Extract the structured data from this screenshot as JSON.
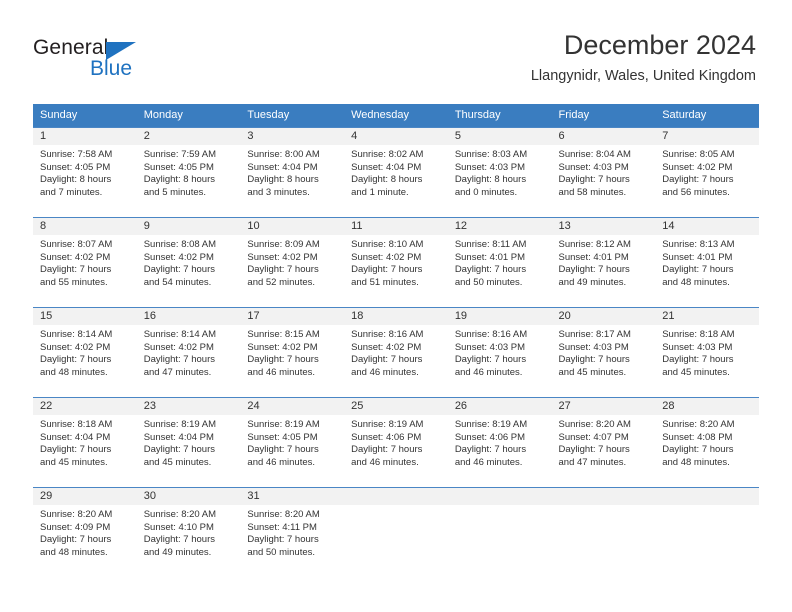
{
  "brand": {
    "name_part1": "General",
    "name_part2": "Blue",
    "accent_color": "#1f72c0"
  },
  "header": {
    "title": "December 2024",
    "subtitle": "Llangynidr, Wales, United Kingdom"
  },
  "theme": {
    "header_row_color": "#3a7dc0",
    "day_band_color": "#f2f2f2",
    "text_color": "#333333"
  },
  "weekday_headers": [
    "Sunday",
    "Monday",
    "Tuesday",
    "Wednesday",
    "Thursday",
    "Friday",
    "Saturday"
  ],
  "weeks": [
    [
      {
        "day": "1",
        "sunrise": "Sunrise: 7:58 AM",
        "sunset": "Sunset: 4:05 PM",
        "daylight_line1": "Daylight: 8 hours",
        "daylight_line2": "and 7 minutes."
      },
      {
        "day": "2",
        "sunrise": "Sunrise: 7:59 AM",
        "sunset": "Sunset: 4:05 PM",
        "daylight_line1": "Daylight: 8 hours",
        "daylight_line2": "and 5 minutes."
      },
      {
        "day": "3",
        "sunrise": "Sunrise: 8:00 AM",
        "sunset": "Sunset: 4:04 PM",
        "daylight_line1": "Daylight: 8 hours",
        "daylight_line2": "and 3 minutes."
      },
      {
        "day": "4",
        "sunrise": "Sunrise: 8:02 AM",
        "sunset": "Sunset: 4:04 PM",
        "daylight_line1": "Daylight: 8 hours",
        "daylight_line2": "and 1 minute."
      },
      {
        "day": "5",
        "sunrise": "Sunrise: 8:03 AM",
        "sunset": "Sunset: 4:03 PM",
        "daylight_line1": "Daylight: 8 hours",
        "daylight_line2": "and 0 minutes."
      },
      {
        "day": "6",
        "sunrise": "Sunrise: 8:04 AM",
        "sunset": "Sunset: 4:03 PM",
        "daylight_line1": "Daylight: 7 hours",
        "daylight_line2": "and 58 minutes."
      },
      {
        "day": "7",
        "sunrise": "Sunrise: 8:05 AM",
        "sunset": "Sunset: 4:02 PM",
        "daylight_line1": "Daylight: 7 hours",
        "daylight_line2": "and 56 minutes."
      }
    ],
    [
      {
        "day": "8",
        "sunrise": "Sunrise: 8:07 AM",
        "sunset": "Sunset: 4:02 PM",
        "daylight_line1": "Daylight: 7 hours",
        "daylight_line2": "and 55 minutes."
      },
      {
        "day": "9",
        "sunrise": "Sunrise: 8:08 AM",
        "sunset": "Sunset: 4:02 PM",
        "daylight_line1": "Daylight: 7 hours",
        "daylight_line2": "and 54 minutes."
      },
      {
        "day": "10",
        "sunrise": "Sunrise: 8:09 AM",
        "sunset": "Sunset: 4:02 PM",
        "daylight_line1": "Daylight: 7 hours",
        "daylight_line2": "and 52 minutes."
      },
      {
        "day": "11",
        "sunrise": "Sunrise: 8:10 AM",
        "sunset": "Sunset: 4:02 PM",
        "daylight_line1": "Daylight: 7 hours",
        "daylight_line2": "and 51 minutes."
      },
      {
        "day": "12",
        "sunrise": "Sunrise: 8:11 AM",
        "sunset": "Sunset: 4:01 PM",
        "daylight_line1": "Daylight: 7 hours",
        "daylight_line2": "and 50 minutes."
      },
      {
        "day": "13",
        "sunrise": "Sunrise: 8:12 AM",
        "sunset": "Sunset: 4:01 PM",
        "daylight_line1": "Daylight: 7 hours",
        "daylight_line2": "and 49 minutes."
      },
      {
        "day": "14",
        "sunrise": "Sunrise: 8:13 AM",
        "sunset": "Sunset: 4:01 PM",
        "daylight_line1": "Daylight: 7 hours",
        "daylight_line2": "and 48 minutes."
      }
    ],
    [
      {
        "day": "15",
        "sunrise": "Sunrise: 8:14 AM",
        "sunset": "Sunset: 4:02 PM",
        "daylight_line1": "Daylight: 7 hours",
        "daylight_line2": "and 48 minutes."
      },
      {
        "day": "16",
        "sunrise": "Sunrise: 8:14 AM",
        "sunset": "Sunset: 4:02 PM",
        "daylight_line1": "Daylight: 7 hours",
        "daylight_line2": "and 47 minutes."
      },
      {
        "day": "17",
        "sunrise": "Sunrise: 8:15 AM",
        "sunset": "Sunset: 4:02 PM",
        "daylight_line1": "Daylight: 7 hours",
        "daylight_line2": "and 46 minutes."
      },
      {
        "day": "18",
        "sunrise": "Sunrise: 8:16 AM",
        "sunset": "Sunset: 4:02 PM",
        "daylight_line1": "Daylight: 7 hours",
        "daylight_line2": "and 46 minutes."
      },
      {
        "day": "19",
        "sunrise": "Sunrise: 8:16 AM",
        "sunset": "Sunset: 4:03 PM",
        "daylight_line1": "Daylight: 7 hours",
        "daylight_line2": "and 46 minutes."
      },
      {
        "day": "20",
        "sunrise": "Sunrise: 8:17 AM",
        "sunset": "Sunset: 4:03 PM",
        "daylight_line1": "Daylight: 7 hours",
        "daylight_line2": "and 45 minutes."
      },
      {
        "day": "21",
        "sunrise": "Sunrise: 8:18 AM",
        "sunset": "Sunset: 4:03 PM",
        "daylight_line1": "Daylight: 7 hours",
        "daylight_line2": "and 45 minutes."
      }
    ],
    [
      {
        "day": "22",
        "sunrise": "Sunrise: 8:18 AM",
        "sunset": "Sunset: 4:04 PM",
        "daylight_line1": "Daylight: 7 hours",
        "daylight_line2": "and 45 minutes."
      },
      {
        "day": "23",
        "sunrise": "Sunrise: 8:19 AM",
        "sunset": "Sunset: 4:04 PM",
        "daylight_line1": "Daylight: 7 hours",
        "daylight_line2": "and 45 minutes."
      },
      {
        "day": "24",
        "sunrise": "Sunrise: 8:19 AM",
        "sunset": "Sunset: 4:05 PM",
        "daylight_line1": "Daylight: 7 hours",
        "daylight_line2": "and 46 minutes."
      },
      {
        "day": "25",
        "sunrise": "Sunrise: 8:19 AM",
        "sunset": "Sunset: 4:06 PM",
        "daylight_line1": "Daylight: 7 hours",
        "daylight_line2": "and 46 minutes."
      },
      {
        "day": "26",
        "sunrise": "Sunrise: 8:19 AM",
        "sunset": "Sunset: 4:06 PM",
        "daylight_line1": "Daylight: 7 hours",
        "daylight_line2": "and 46 minutes."
      },
      {
        "day": "27",
        "sunrise": "Sunrise: 8:20 AM",
        "sunset": "Sunset: 4:07 PM",
        "daylight_line1": "Daylight: 7 hours",
        "daylight_line2": "and 47 minutes."
      },
      {
        "day": "28",
        "sunrise": "Sunrise: 8:20 AM",
        "sunset": "Sunset: 4:08 PM",
        "daylight_line1": "Daylight: 7 hours",
        "daylight_line2": "and 48 minutes."
      }
    ],
    [
      {
        "day": "29",
        "sunrise": "Sunrise: 8:20 AM",
        "sunset": "Sunset: 4:09 PM",
        "daylight_line1": "Daylight: 7 hours",
        "daylight_line2": "and 48 minutes."
      },
      {
        "day": "30",
        "sunrise": "Sunrise: 8:20 AM",
        "sunset": "Sunset: 4:10 PM",
        "daylight_line1": "Daylight: 7 hours",
        "daylight_line2": "and 49 minutes."
      },
      {
        "day": "31",
        "sunrise": "Sunrise: 8:20 AM",
        "sunset": "Sunset: 4:11 PM",
        "daylight_line1": "Daylight: 7 hours",
        "daylight_line2": "and 50 minutes."
      },
      {
        "day": "",
        "sunrise": "",
        "sunset": "",
        "daylight_line1": "",
        "daylight_line2": ""
      },
      {
        "day": "",
        "sunrise": "",
        "sunset": "",
        "daylight_line1": "",
        "daylight_line2": ""
      },
      {
        "day": "",
        "sunrise": "",
        "sunset": "",
        "daylight_line1": "",
        "daylight_line2": ""
      },
      {
        "day": "",
        "sunrise": "",
        "sunset": "",
        "daylight_line1": "",
        "daylight_line2": ""
      }
    ]
  ]
}
